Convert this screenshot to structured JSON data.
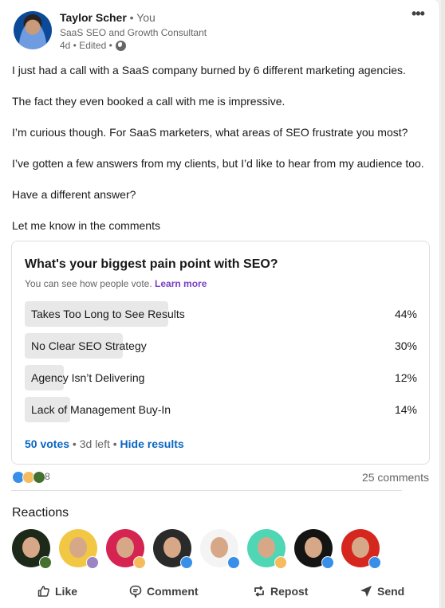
{
  "author": {
    "name": "Taylor Scher",
    "relation": " • You",
    "headline": "SaaS SEO and Growth Consultant",
    "meta": "4d • Edited •"
  },
  "post": {
    "paragraphs": [
      "I just had a call with a SaaS company burned by 6 different marketing agencies.",
      "The fact they even booked a call with me is impressive.",
      "I’m curious though. For SaaS marketers, what areas of SEO frustrate you most?",
      "I’ve gotten a few answers from my clients, but I’d like to hear from my audience too.",
      "Have a different answer?",
      "Let me know in the comments"
    ]
  },
  "poll": {
    "question": "What's your biggest pain point with SEO?",
    "note": "You can see how people vote.",
    "learn_more": "Learn more",
    "options": [
      {
        "label": "Takes Too Long to See Results",
        "percent": 44,
        "percent_label": "44%"
      },
      {
        "label": "No Clear SEO Strategy",
        "percent": 30,
        "percent_label": "30%"
      },
      {
        "label": "Agency Isn’t Delivering",
        "percent": 12,
        "percent_label": "12%"
      },
      {
        "label": "Lack of Management Buy-In",
        "percent": 14,
        "percent_label": "14%"
      }
    ],
    "votes": "50 votes",
    "time_left": " • 3d left • ",
    "hide_results": "Hide results"
  },
  "social": {
    "reaction_types": [
      "like",
      "insightful",
      "support"
    ],
    "reaction_count": "8",
    "comments": "25 comments"
  },
  "reactions": {
    "heading": "Reactions",
    "people": [
      {
        "bg": "#1d2a1a",
        "reaction": "support"
      },
      {
        "bg": "#f2c744",
        "reaction": "love"
      },
      {
        "bg": "#d52352",
        "reaction": "insightful"
      },
      {
        "bg": "#2a2a2a",
        "reaction": "like"
      },
      {
        "bg": "#f4f4f4",
        "reaction": "like"
      },
      {
        "bg": "#4fd6b5",
        "reaction": "insightful"
      },
      {
        "bg": "#141414",
        "reaction": "like"
      },
      {
        "bg": "#d5271d",
        "reaction": "like"
      }
    ]
  },
  "reaction_colors": {
    "like": "#378fe9",
    "insightful": "#f5bb5c",
    "support": "#44712e",
    "love": "#9b83c4"
  },
  "actions": {
    "like": "Like",
    "comment": "Comment",
    "repost": "Repost",
    "send": "Send"
  },
  "colors": {
    "link_blue": "#0a66c2",
    "learn_more_purple": "#7b3fc7"
  }
}
